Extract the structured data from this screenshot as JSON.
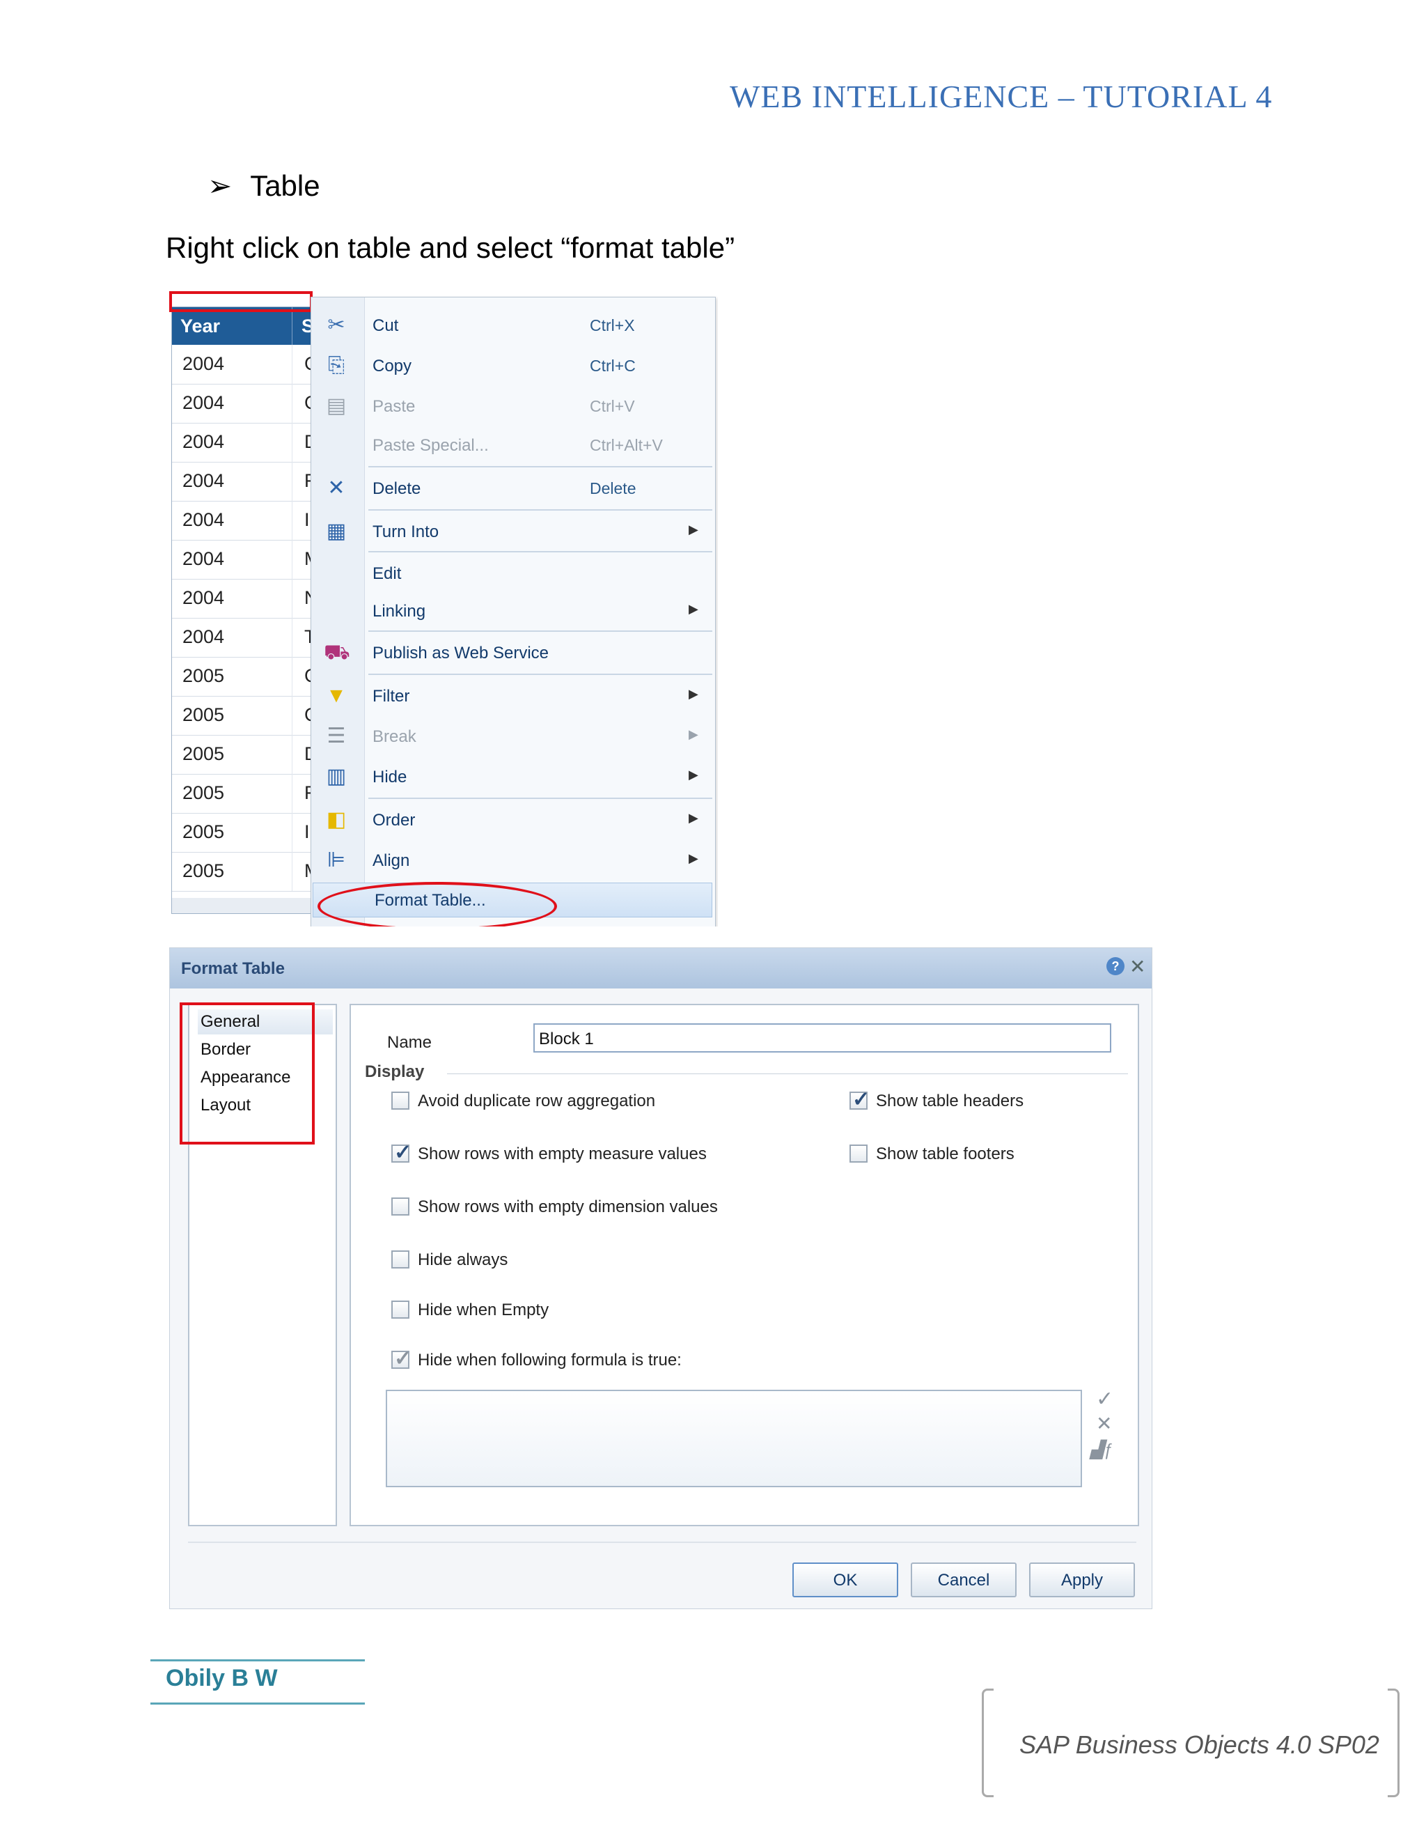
{
  "header": {
    "title": "WEB INTELLIGENCE – TUTORIAL 4"
  },
  "bullet": {
    "text": "Table"
  },
  "instruction": "Right click on table and select “format table”",
  "table": {
    "header_year": "Year",
    "header_second": "S",
    "rows": [
      {
        "year": "2004",
        "c": "C"
      },
      {
        "year": "2004",
        "c": "C"
      },
      {
        "year": "2004",
        "c": "D"
      },
      {
        "year": "2004",
        "c": "F"
      },
      {
        "year": "2004",
        "c": "I"
      },
      {
        "year": "2004",
        "c": "M"
      },
      {
        "year": "2004",
        "c": "N"
      },
      {
        "year": "2004",
        "c": "T"
      },
      {
        "year": "2005",
        "c": "C"
      },
      {
        "year": "2005",
        "c": "C"
      },
      {
        "year": "2005",
        "c": "D"
      },
      {
        "year": "2005",
        "c": "F"
      },
      {
        "year": "2005",
        "c": "I"
      },
      {
        "year": "2005",
        "c": "M"
      }
    ]
  },
  "context_menu": {
    "items": [
      {
        "label": "Cut",
        "shortcut": "Ctrl+X",
        "icon": "scissors-icon"
      },
      {
        "label": "Copy",
        "shortcut": "Ctrl+C",
        "icon": "copy-icon"
      },
      {
        "label": "Paste",
        "shortcut": "Ctrl+V",
        "icon": "paste-icon"
      },
      {
        "label": "Paste Special...",
        "shortcut": "Ctrl+Alt+V"
      },
      {
        "label": "Delete",
        "shortcut": "Delete",
        "icon": "delete-icon"
      },
      {
        "label": "Turn Into",
        "icon": "turn-into-icon"
      },
      {
        "label": "Edit"
      },
      {
        "label": "Linking"
      },
      {
        "label": "Publish as Web Service",
        "icon": "publish-icon"
      },
      {
        "label": "Filter",
        "icon": "filter-icon"
      },
      {
        "label": "Break",
        "icon": "break-icon"
      },
      {
        "label": "Hide",
        "icon": "hide-icon"
      },
      {
        "label": "Order",
        "icon": "order-icon"
      },
      {
        "label": "Align",
        "icon": "align-icon"
      },
      {
        "label": "Format Table..."
      }
    ]
  },
  "dialog": {
    "title": "Format Table",
    "nav": [
      "General",
      "Border",
      "Appearance",
      "Layout"
    ],
    "name_label": "Name",
    "name_value": "Block 1",
    "display_label": "Display",
    "checkboxes": [
      {
        "label": "Avoid duplicate row aggregation",
        "checked": false
      },
      {
        "label": "Show table headers",
        "checked": true
      },
      {
        "label": "Show rows with empty measure values",
        "checked": true
      },
      {
        "label": "Show table footers",
        "checked": false
      },
      {
        "label": "Show rows with empty dimension values",
        "checked": false
      },
      {
        "label": "Hide always",
        "checked": false
      },
      {
        "label": "Hide when Empty",
        "checked": false
      },
      {
        "label": "Hide when following formula is true:",
        "checked": true
      }
    ],
    "buttons": {
      "ok": "OK",
      "cancel": "Cancel",
      "apply": "Apply"
    }
  },
  "footer": {
    "author": "Obily B W",
    "product": "SAP Business Objects 4.0 SP02"
  },
  "colors": {
    "accent": "#3a6fb5",
    "table_header": "#1f5c97",
    "highlight_red": "#e0101a",
    "author": "#2a7f97"
  }
}
